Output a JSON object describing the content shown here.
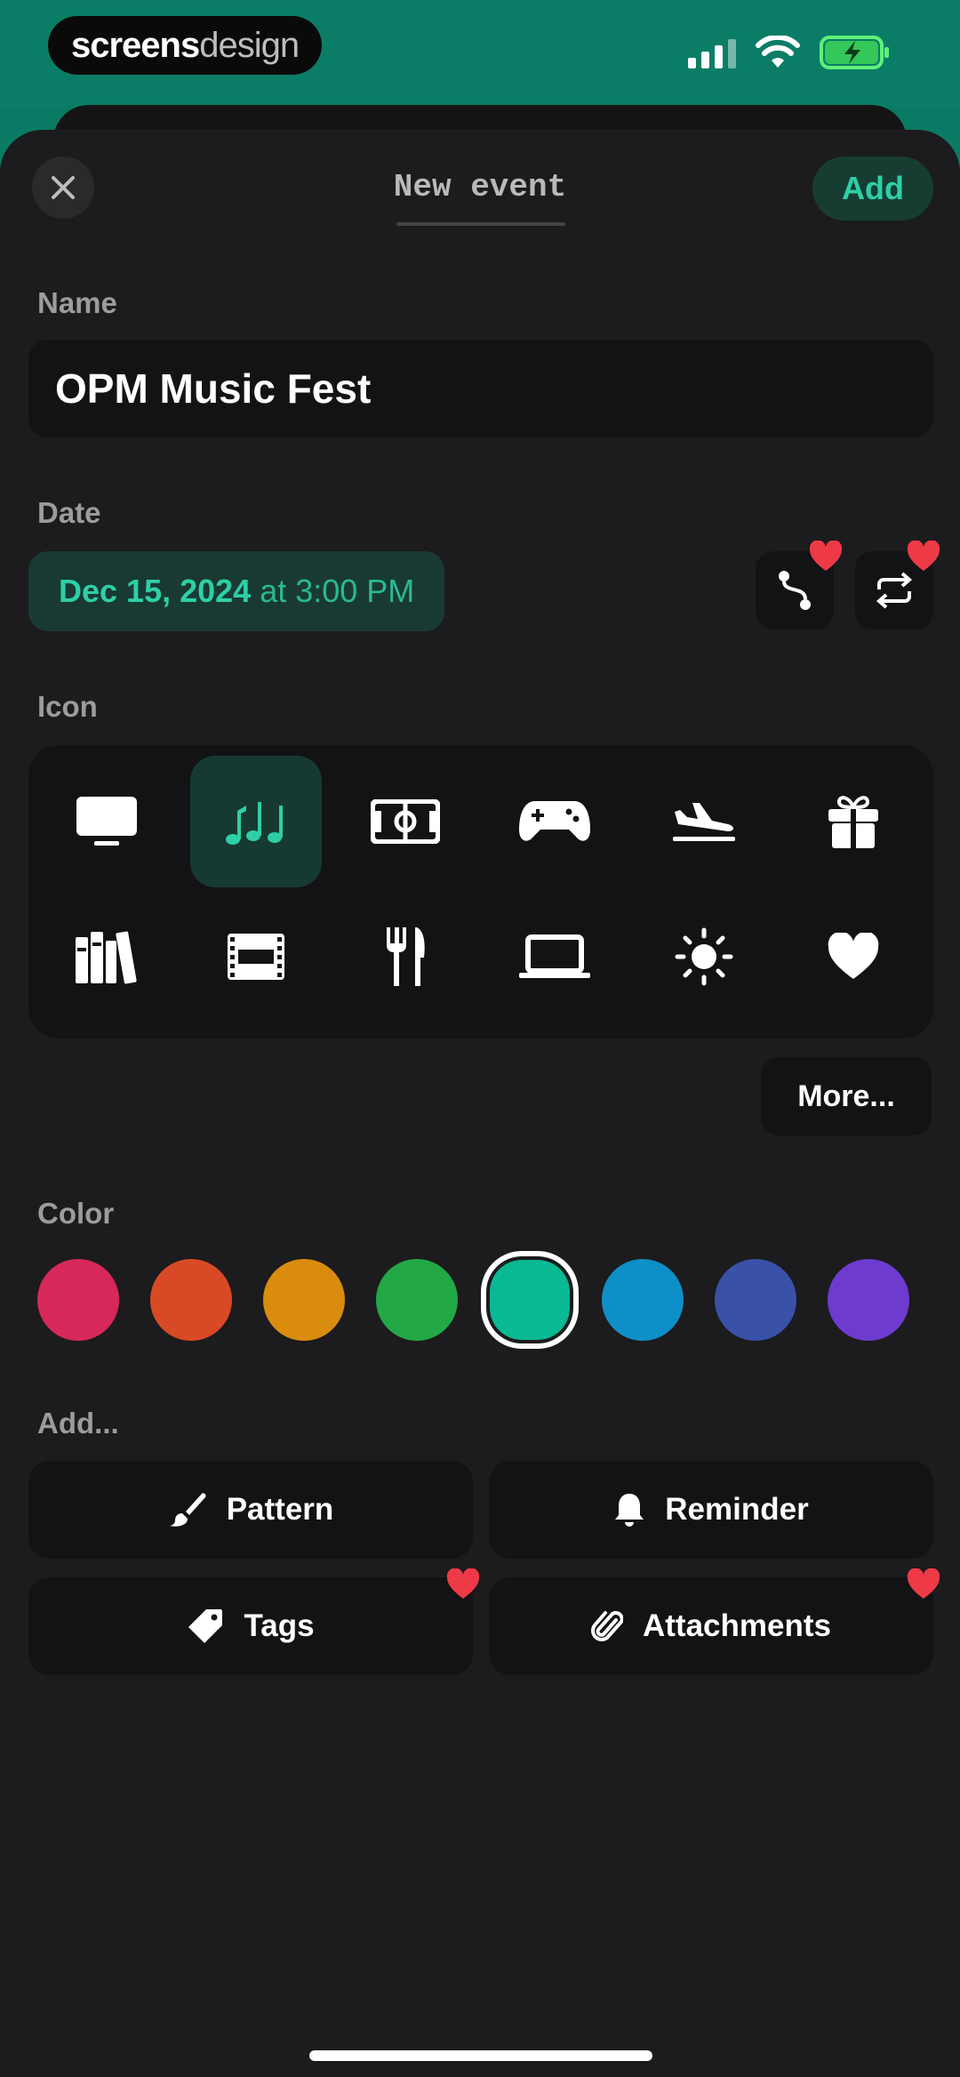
{
  "status_bar": {
    "brand_part1": "screens",
    "brand_part2": "design"
  },
  "header": {
    "title": "New event",
    "add_label": "Add"
  },
  "name_section": {
    "label": "Name",
    "value": "OPM Music Fest"
  },
  "date_section": {
    "label": "Date",
    "date": "Dec 15, 2024",
    "at": "at",
    "time": "3:00 PM"
  },
  "icon_section": {
    "label": "Icon",
    "icons": [
      "tv-icon",
      "music-notes-icon",
      "stadium-icon",
      "gamepad-icon",
      "airplane-landing-icon",
      "gift-icon",
      "books-icon",
      "film-icon",
      "fork-knife-icon",
      "laptop-icon",
      "sun-icon",
      "heart-icon"
    ],
    "selected": "music-notes-icon",
    "more_label": "More..."
  },
  "color_section": {
    "label": "Color",
    "colors": [
      "#d8285a",
      "#d84a26",
      "#d98c0e",
      "#22a847",
      "#08b993",
      "#0f8fc7",
      "#3951a8",
      "#6d3ccf"
    ],
    "selected_index": 4
  },
  "add_section": {
    "label": "Add...",
    "pattern": "Pattern",
    "reminder": "Reminder",
    "tags": "Tags",
    "attachments": "Attachments"
  },
  "accent_color": "#2ecfa6"
}
